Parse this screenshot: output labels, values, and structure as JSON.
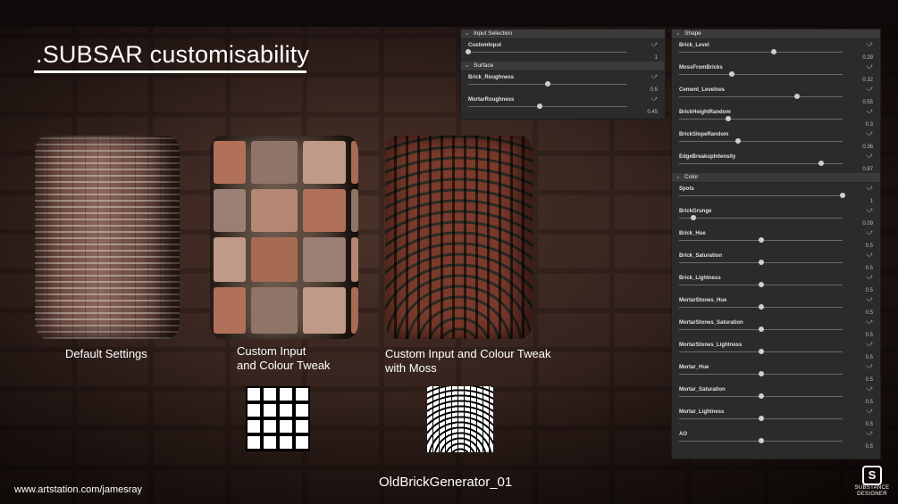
{
  "title": ".SUBSAR customisability",
  "captions": {
    "default": "Default Settings",
    "custom_line1": "Custom Input",
    "custom_line2": "and Colour Tweak",
    "moss_line1": "Custom Input and Colour Tweak",
    "moss_line2": "with Moss"
  },
  "graph_name": "OldBrickGenerator_01",
  "website": "www.artstation.com/jamesray",
  "logo": {
    "line1": "SUBSTANCE",
    "line2": "DESIGNER"
  },
  "icons": {
    "section_chevron": "chevron-down-icon",
    "param_reset": "reset-icon",
    "logo": "substance-designer-logo"
  },
  "panel_left": {
    "sections": [
      {
        "title": "Input Selection",
        "params": [
          {
            "name": "CustomInput",
            "value": "1",
            "ratio": 0.0
          }
        ]
      },
      {
        "title": "Surface",
        "params": [
          {
            "name": "Brick_Roughness",
            "value": "0.5",
            "ratio": 0.5
          },
          {
            "name": "MortarRoughness",
            "value": "0.45",
            "ratio": 0.45
          }
        ]
      }
    ]
  },
  "panel_right": {
    "sections": [
      {
        "title": "Shape",
        "params": [
          {
            "name": "Brick_Level",
            "value": "0.29",
            "ratio": 0.58
          },
          {
            "name": "MossFromBricks",
            "value": "0.32",
            "ratio": 0.32
          },
          {
            "name": "Cement_Levelnes",
            "value": "0.55",
            "ratio": 0.72
          },
          {
            "name": "BrickHeightRandom",
            "value": "0.3",
            "ratio": 0.3
          },
          {
            "name": "BrickSlopeRandom",
            "value": "0.36",
            "ratio": 0.36
          },
          {
            "name": "EdgeBreakupIntensity",
            "value": "0.87",
            "ratio": 0.87
          }
        ]
      },
      {
        "title": "Color",
        "params": [
          {
            "name": "Spots",
            "value": "1",
            "ratio": 1.0
          },
          {
            "name": "BrickGrunge",
            "value": "0.09",
            "ratio": 0.09
          },
          {
            "name": "Brick_Hue",
            "value": "0.5",
            "ratio": 0.5
          },
          {
            "name": "Brick_Saturation",
            "value": "0.5",
            "ratio": 0.5
          },
          {
            "name": "Brick_Lightness",
            "value": "0.5",
            "ratio": 0.5
          },
          {
            "name": "MortarStones_Hue",
            "value": "0.5",
            "ratio": 0.5
          },
          {
            "name": "MortarStones_Saturation",
            "value": "0.5",
            "ratio": 0.5
          },
          {
            "name": "MortarStones_Lightness",
            "value": "0.5",
            "ratio": 0.5
          },
          {
            "name": "Mortar_Hue",
            "value": "0.5",
            "ratio": 0.5
          },
          {
            "name": "Mortar_Saturation",
            "value": "0.5",
            "ratio": 0.5
          },
          {
            "name": "Mortar_Lightness",
            "value": "0.5",
            "ratio": 0.5
          },
          {
            "name": "AO",
            "value": "0.5",
            "ratio": 0.5
          }
        ]
      }
    ]
  }
}
